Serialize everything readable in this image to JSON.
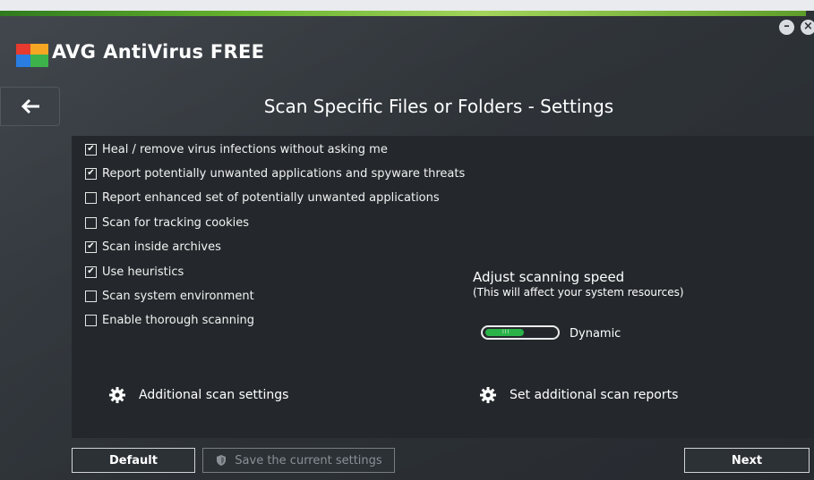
{
  "app": {
    "brand": "AVG",
    "product": "AntiVirus FREE"
  },
  "window_controls": {
    "minimize": "–",
    "close": "×"
  },
  "page": {
    "title": "Scan Specific Files or Folders - Settings"
  },
  "options": [
    {
      "label": "Heal / remove virus infections without asking me",
      "checked": true
    },
    {
      "label": "Report potentially unwanted applications and spyware threats",
      "checked": true
    },
    {
      "label": "Report enhanced set of potentially unwanted applications",
      "checked": false
    },
    {
      "label": "Scan for tracking cookies",
      "checked": false
    },
    {
      "label": "Scan inside archives",
      "checked": true
    },
    {
      "label": "Use heuristics",
      "checked": true
    },
    {
      "label": "Scan system environment",
      "checked": false
    },
    {
      "label": "Enable thorough scanning",
      "checked": false
    }
  ],
  "speed": {
    "title": "Adjust scanning speed",
    "subtitle": "(This will affect your system resources)",
    "value_label": "Dynamic",
    "level": 0.55,
    "grip": "III"
  },
  "links": {
    "additional_settings": "Additional scan settings",
    "additional_reports": "Set additional scan reports"
  },
  "buttons": {
    "default": "Default",
    "save": "Save the current settings",
    "next": "Next"
  },
  "colors": {
    "accent_green": "#66b32e",
    "slider_green": "#2bb34a",
    "panel": "#24282c"
  }
}
